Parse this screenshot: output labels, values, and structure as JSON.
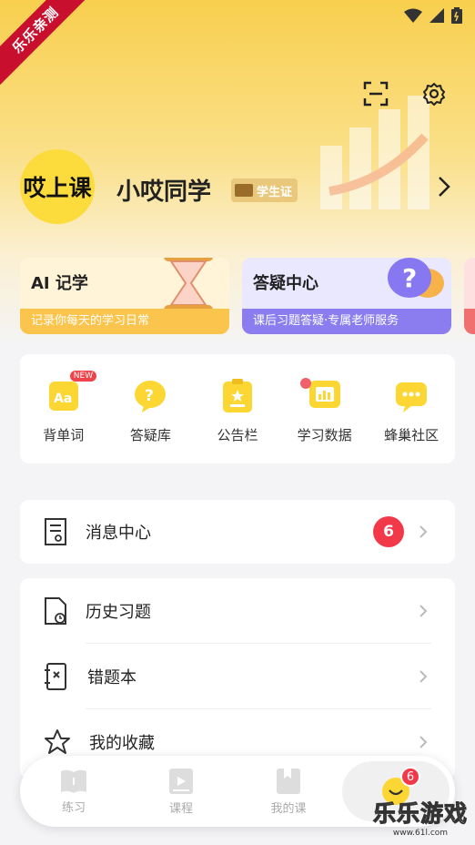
{
  "ribbon": "乐乐亲测",
  "profile": {
    "avatar_text": "哎上课",
    "name": "小哎同学",
    "badge": "学生证"
  },
  "features": [
    {
      "title": "AI 记学",
      "subtitle": "记录你每天的学习日常"
    },
    {
      "title": "答疑中心",
      "subtitle": "课后习题答疑·专属老师服务"
    }
  ],
  "quick_actions": [
    {
      "label": "背单词",
      "badge": "NEW"
    },
    {
      "label": "答疑库"
    },
    {
      "label": "公告栏"
    },
    {
      "label": "学习数据"
    },
    {
      "label": "蜂巢社区"
    }
  ],
  "message_center": {
    "label": "消息中心",
    "count": "6"
  },
  "list_items": [
    {
      "label": "历史习题"
    },
    {
      "label": "错题本"
    },
    {
      "label": "我的收藏"
    }
  ],
  "tabs": [
    {
      "label": "练习"
    },
    {
      "label": "课程"
    },
    {
      "label": "我的课"
    }
  ],
  "active_tab_badge": "6",
  "watermark": {
    "title": "乐乐游戏",
    "url": "www.61l.com"
  },
  "colors": {
    "accent": "#fbdc3c",
    "badge_red": "#f2394a",
    "purple": "#8b7df0"
  }
}
